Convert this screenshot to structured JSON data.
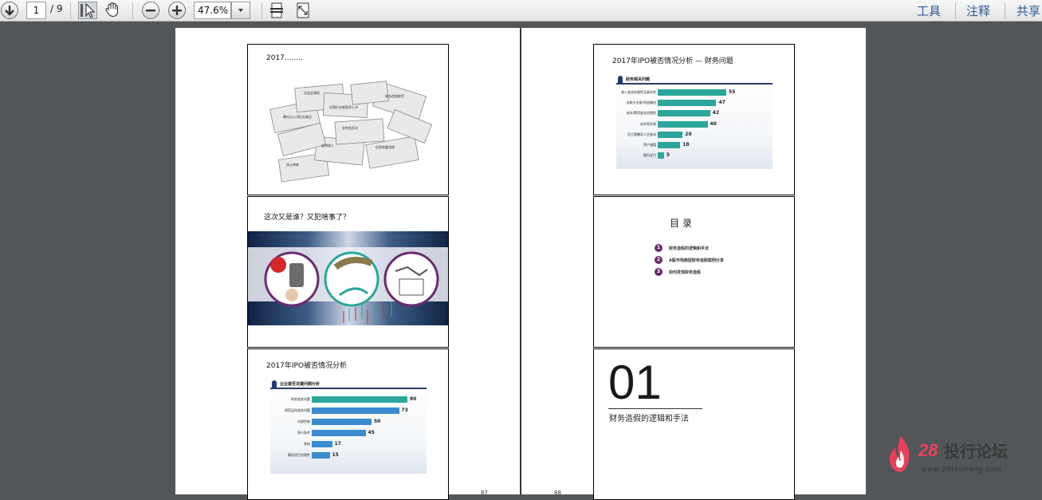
{
  "toolbar": {
    "current_page": "1",
    "page_total": "/ 9",
    "zoom": "47.6%",
    "menu_tools": "工具",
    "menu_comment": "注释",
    "menu_share": "共享"
  },
  "page_numbers": {
    "left": "87",
    "right": "88"
  },
  "slide1": {
    "title": "2017........",
    "news_snippets": [
      "曝光后公司仍在被告",
      "近期仍在被暂停上市",
      "财务造假被罚",
      "证监会通报",
      "发审会否决",
      "信息披露违规",
      "终止审查",
      "虚增收入"
    ]
  },
  "slide2": {
    "title": "这次又是谁？又犯啥事了？"
  },
  "slide3": {
    "title": "2017年IPO被否情况分析",
    "chart_title": "企业被否关键问题分析"
  },
  "slide4": {
    "title": "2017年IPO被否情况分析 — 财务问题",
    "chart_title": "财务相关问题"
  },
  "slide5": {
    "title": "目 录",
    "items": [
      {
        "num": "1",
        "text": "财务造假的逻辑和手法"
      },
      {
        "num": "2",
        "text": "A股市场典型财务造假案例分享"
      },
      {
        "num": "3",
        "text": "如何发现财务造假"
      }
    ]
  },
  "slide6": {
    "number": "01",
    "subtitle": "财务造假的逻辑和手法"
  },
  "watermark": {
    "brand_num": "28",
    "brand_text": "投行论坛",
    "url": "www.28touhang.com"
  },
  "colors": {
    "teal": "#2aa79a",
    "blue": "#3a8ccf",
    "navy": "#2a3d6b",
    "purple": "#6b2b6e",
    "link": "#2f5a95"
  },
  "chart_data": [
    {
      "type": "bar",
      "orientation": "horizontal",
      "title": "企业被否关键问题分析",
      "categories": [
        "财务相关问题",
        "规范运作相关问题",
        "内部控制",
        "发行条件",
        "其他",
        "募投项目合理性"
      ],
      "values": [
        80,
        73,
        50,
        45,
        17,
        15
      ],
      "colors": [
        "#2aa79a",
        "#3a8ccf",
        "#3a8ccf",
        "#3a8ccf",
        "#3a8ccf",
        "#3a8ccf"
      ]
    },
    {
      "type": "bar",
      "orientation": "horizontal",
      "title": "财务相关问题",
      "categories": [
        "收入变动合理性及真实性",
        "关联方交易/利益输送",
        "成本/费用变动合理性",
        "毛利率异常",
        "员工薪酬及人员变动",
        "资产减值",
        "股份支付"
      ],
      "values": [
        55,
        47,
        42,
        40,
        20,
        18,
        5
      ],
      "colors": [
        "#2aa79a",
        "#2aa79a",
        "#2aa79a",
        "#2aa79a",
        "#2aa79a",
        "#2aa79a",
        "#2aa79a"
      ]
    }
  ]
}
